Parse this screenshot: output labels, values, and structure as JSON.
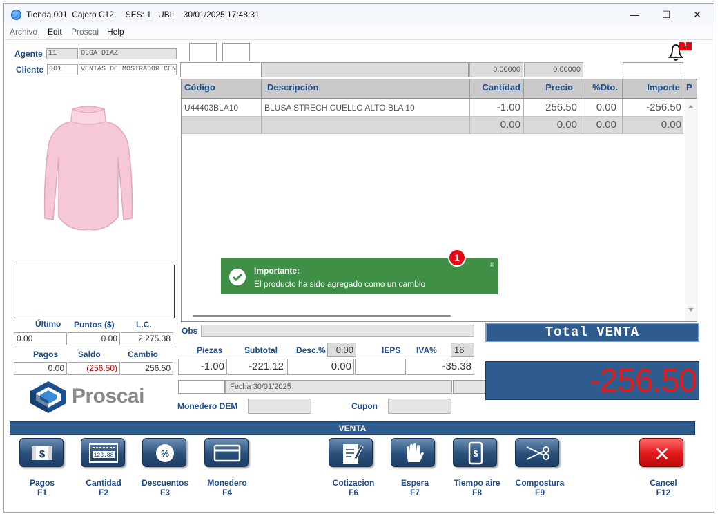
{
  "titlebar": {
    "title": "Tienda.001  Cajero C12     SES: 1   UBI:    30/01/2025 17:48:31"
  },
  "window_controls": {
    "minimize": "—",
    "maximize": "☐",
    "close": "✕"
  },
  "menu": [
    "Archivo",
    "Edit",
    "Proscai",
    "Help"
  ],
  "agente": {
    "label": "Agente",
    "code": "11",
    "name": "OLGA DIAZ"
  },
  "cliente": {
    "label": "Cliente",
    "code": "001",
    "name": "VENTAS DE MOSTRADOR CENTRO"
  },
  "notifications": {
    "count": "1"
  },
  "top_row": {
    "val1": "0.00000",
    "val2": "0.00000"
  },
  "grid": {
    "columns": [
      "Código",
      "Descripción",
      "Cantidad",
      "Precio",
      "%Dto.",
      "Importe",
      "P"
    ],
    "rows": [
      [
        "U44403BLA10",
        "BLUSA STRECH CUELLO ALTO BLA 10",
        "-1.00",
        "256.50",
        "0.00",
        "-256.50"
      ],
      [
        "",
        "",
        "0.00",
        "0.00",
        "0.00",
        "0.00"
      ]
    ]
  },
  "toast": {
    "title": "Importante:",
    "message": "El producto ha sido agregado como un cambio",
    "close": "x",
    "marker": "1"
  },
  "stats1": {
    "labels": [
      "Último",
      "Puntos ($)",
      "L.C."
    ],
    "values": [
      "0.00",
      "0.00",
      "2,275.38"
    ]
  },
  "stats2": {
    "labels": [
      "Pagos",
      "Saldo",
      "Cambio"
    ],
    "values": [
      "0.00",
      "(256.50)",
      "256.50"
    ]
  },
  "brand": {
    "name": "Proscai"
  },
  "obs": {
    "label": "Obs"
  },
  "totals": {
    "labels": [
      "Piezas",
      "Subtotal",
      "Desc.%",
      "IEPS",
      "IVA%"
    ],
    "desc_pct": "0.00",
    "iva_pct": "16",
    "values": [
      "-1.00",
      "-221.12",
      "0.00",
      "",
      "-35.38"
    ]
  },
  "fecha": "Fecha 30/01/2025",
  "monedero": {
    "label": "Monedero DEM"
  },
  "cupon": {
    "label": "Cupon"
  },
  "total": {
    "header": "Total VENTA",
    "value": "-256.50"
  },
  "section": {
    "title": "VENTA"
  },
  "actions": [
    {
      "name": "Pagos",
      "key": "F1"
    },
    {
      "name": "Cantidad",
      "key": "F2"
    },
    {
      "name": "Descuentos",
      "key": "F3"
    },
    {
      "name": "Monedero",
      "key": "F4"
    },
    {
      "name": "Cotizacion",
      "key": "F6"
    },
    {
      "name": "Espera",
      "key": "F7"
    },
    {
      "name": "Tiempo aire",
      "key": "F8"
    },
    {
      "name": "Compostura",
      "key": "F9"
    },
    {
      "name": "Cancel",
      "key": "F12"
    }
  ],
  "icons": {
    "pay_symbol": "$",
    "percent_symbol": "%",
    "calc_display": "123.88",
    "cancel_symbol": "✕"
  },
  "colors": {
    "accent": "#2e5c8e",
    "label": "#1f4e8c",
    "total_red": "#e01b1b",
    "toast_green": "#3f8f47"
  }
}
